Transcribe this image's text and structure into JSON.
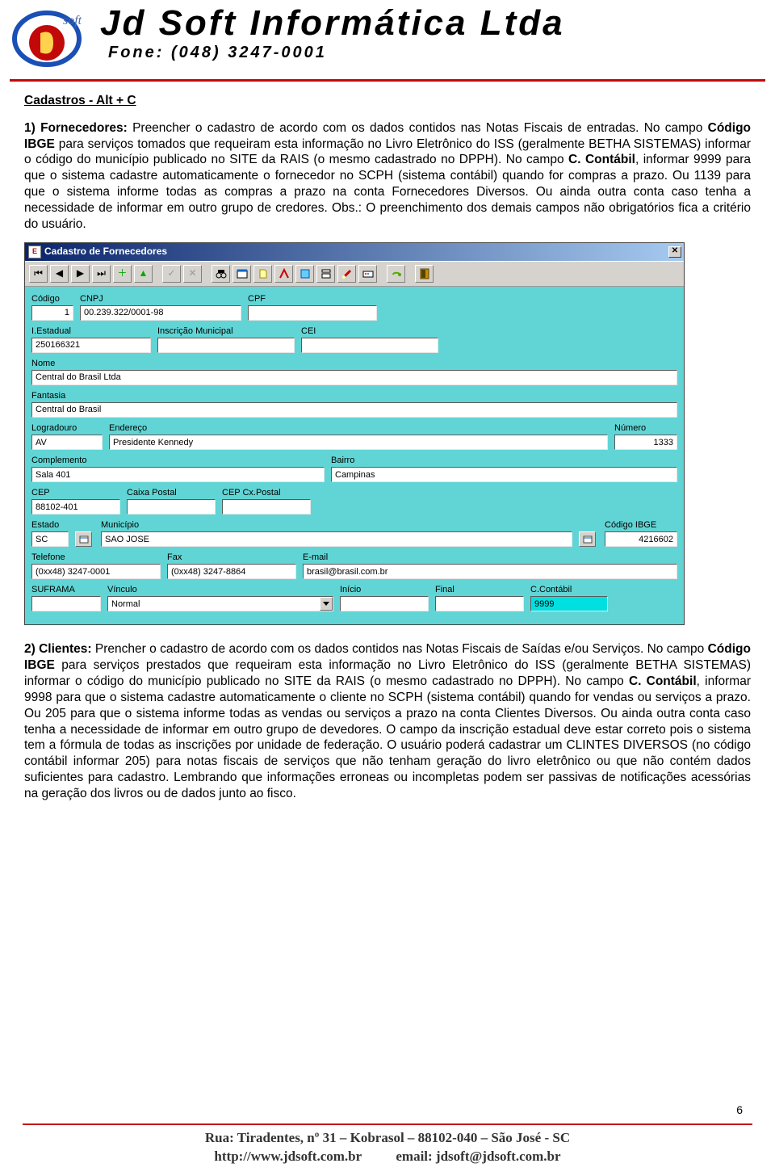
{
  "header": {
    "company": "Jd Soft Informática Ltda",
    "phone": "Fone: (048) 3247-0001"
  },
  "section_title": "Cadastros - Alt + C",
  "para1_parts": {
    "lead": "1) Fornecedores:",
    "t1": " Preencher o cadastro de acordo com os dados contidos nas Notas Fiscais de entradas. No campo ",
    "b1": "Código IBGE",
    "t2": " para serviços tomados que requeiram esta informação no Livro Eletrônico do ISS (geralmente BETHA SISTEMAS) informar o código do município publicado no SITE da RAIS (o mesmo cadastrado no DPPH). No campo ",
    "b2": "C. Contábil",
    "t3": ", informar 9999 para que o sistema cadastre automaticamente o fornecedor no SCPH (sistema contábil) quando for compras a prazo. Ou 1139 para que o sistema informe todas as compras a prazo  na conta Fornecedores Diversos. Ou ainda outra conta caso tenha a necessidade de informar em outro grupo de credores. Obs.: O preenchimento dos demais campos não obrigatórios fica a critério do usuário."
  },
  "para2_parts": {
    "lead": "2) Clientes:",
    "t1": " Prencher o cadastro de acordo com os dados contidos nas Notas Fiscais de Saídas e/ou Serviços. No campo ",
    "b1": "Código IBGE",
    "t2": "  para serviços prestados que requeiram esta informação no Livro Eletrônico do ISS (geralmente BETHA SISTEMAS) informar o código do município publicado no SITE da RAIS (o mesmo cadastrado no DPPH). No campo ",
    "b2": "C. Contábil",
    "t3": ", informar 9998 para que o sistema cadastre automaticamente o cliente no SCPH (sistema contábil) quando for vendas ou serviços a prazo. Ou 205 para que o sistema informe todas as vendas ou serviços a prazo  na conta Clientes Diversos. Ou ainda outra conta caso tenha a necessidade de informar em outro grupo de devedores. O campo da inscrição estadual deve estar correto pois o sistema tem a fórmula de todas as inscrições por unidade de federação. O usuário poderá cadastrar um CLINTES DIVERSOS (no código contábil informar 205) para notas fiscais de serviços que não tenham geração do livro eletrônico ou que não contém dados suficientes para cadastro. Lembrando que informações erroneas ou incompletas podem ser passivas de notificações acessórias na geração dos livros ou de dados junto ao fisco."
  },
  "form": {
    "title": "Cadastro de Fornecedores",
    "labels": {
      "codigo": "Código",
      "cnpj": "CNPJ",
      "cpf": "CPF",
      "iestadual": "I.Estadual",
      "inscmun": "Inscrição Municipal",
      "cei": "CEI",
      "nome": "Nome",
      "fantasia": "Fantasia",
      "logradouro": "Logradouro",
      "endereco": "Endereço",
      "numero": "Número",
      "complemento": "Complemento",
      "bairro": "Bairro",
      "cep": "CEP",
      "cxp": "Caixa Postal",
      "cepcx": "CEP Cx.Postal",
      "estado": "Estado",
      "municipio": "Município",
      "codibge": "Código IBGE",
      "telefone": "Telefone",
      "fax": "Fax",
      "email": "E-mail",
      "suframa": "SUFRAMA",
      "vinculo": "Vínculo",
      "inicio": "Início",
      "final": "Final",
      "ccontabil": "C.Contábil"
    },
    "values": {
      "codigo": "1",
      "cnpj": "00.239.322/0001-98",
      "cpf": "",
      "iestadual": "250166321",
      "inscmun": "",
      "cei": "",
      "nome": "Central do Brasil Ltda",
      "fantasia": "Central do Brasil",
      "logradouro": "AV",
      "endereco": "Presidente Kennedy",
      "numero": "1333",
      "complemento": "Sala 401",
      "bairro": "Campinas",
      "cep": "88102-401",
      "cxp": "",
      "cepcx": "",
      "estado": "SC",
      "municipio": "SAO JOSE",
      "codibge": "4216602",
      "telefone": "(0xx48) 3247-0001",
      "fax": "(0xx48) 3247-8864",
      "email": "brasil@brasil.com.br",
      "suframa": "",
      "vinculo": "Normal",
      "inicio": "",
      "final": "",
      "ccontabil": "9999"
    }
  },
  "page_number": "6",
  "footer": {
    "line1": "Rua: Tiradentes, nº 31 – Kobrasol – 88102-040 – São José - SC",
    "line2_left": "http://www.jdsoft.com.br",
    "line2_right": "email: jdsoft@jdsoft.com.br"
  }
}
